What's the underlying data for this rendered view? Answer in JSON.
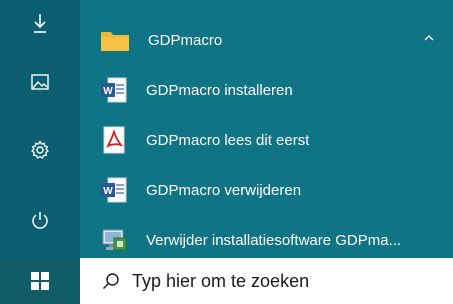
{
  "menu": {
    "group": {
      "label": "GDPmacro",
      "icon": "folder-icon",
      "expanded": true
    },
    "items": [
      {
        "label": "GDPmacro installeren",
        "icon": "word-document-icon"
      },
      {
        "label": "GDPmacro lees dit eerst",
        "icon": "pdf-document-icon"
      },
      {
        "label": "GDPmacro verwijderen",
        "icon": "word-document-icon"
      },
      {
        "label": "Verwijder installatiesoftware GDPma...",
        "icon": "uninstall-program-icon"
      }
    ]
  },
  "rail": {
    "items": [
      {
        "icon": "downloads-icon"
      },
      {
        "icon": "pictures-icon"
      },
      {
        "icon": "settings-gear-icon"
      },
      {
        "icon": "power-icon"
      }
    ]
  },
  "taskbar": {
    "start_icon": "windows-logo-icon",
    "search_placeholder": "Typ hier om te zoeken"
  },
  "colors": {
    "accent": "#107487",
    "rail": "#0c5f70",
    "taskbar": "#0f5b68"
  }
}
